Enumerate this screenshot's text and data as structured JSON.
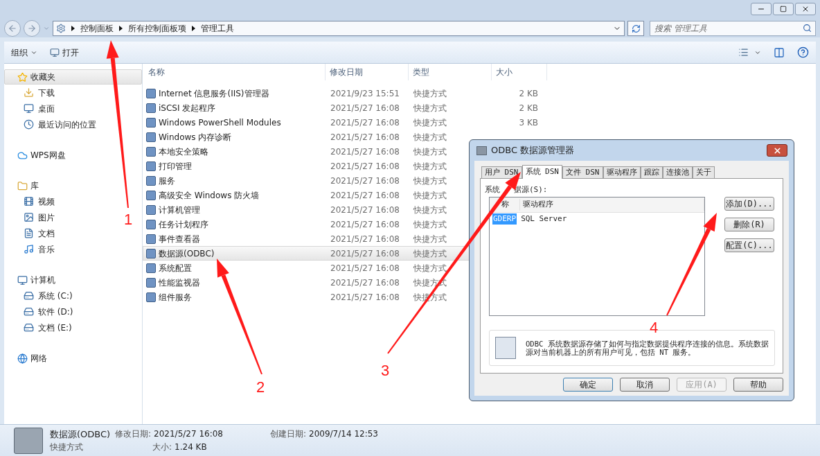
{
  "address_bar": {
    "breadcrumbs": [
      "控制面板",
      "所有控制面板项",
      "管理工具"
    ]
  },
  "search": {
    "placeholder": "搜索 管理工具"
  },
  "toolbar": {
    "items": [
      {
        "label": "组织",
        "kind": "menu"
      },
      {
        "label": "打开",
        "kind": "button"
      }
    ]
  },
  "sidebar": {
    "groups": [
      {
        "label": "收藏夹",
        "selected": true,
        "kind": "star",
        "children": [
          {
            "label": "下载",
            "kind": "download"
          },
          {
            "label": "桌面",
            "kind": "desktop"
          },
          {
            "label": "最近访问的位置",
            "kind": "recent"
          }
        ]
      },
      {
        "label": "WPS网盘",
        "selected": false,
        "kind": "cloud"
      },
      {
        "label": "库",
        "selected": false,
        "kind": "folder",
        "children": [
          {
            "label": "视频",
            "kind": "video"
          },
          {
            "label": "图片",
            "kind": "image"
          },
          {
            "label": "文档",
            "kind": "doc"
          },
          {
            "label": "音乐",
            "kind": "music"
          }
        ]
      },
      {
        "label": "计算机",
        "selected": false,
        "kind": "computer",
        "children": [
          {
            "label": "系统 (C:)",
            "kind": "drive"
          },
          {
            "label": "软件 (D:)",
            "kind": "drive"
          },
          {
            "label": "文档 (E:)",
            "kind": "drive"
          }
        ]
      },
      {
        "label": "网络",
        "selected": false,
        "kind": "network"
      }
    ]
  },
  "file_list": {
    "columns": [
      "名称",
      "修改日期",
      "类型",
      "大小"
    ],
    "rows": [
      {
        "name": "Internet 信息服务(IIS)管理器",
        "date": "2021/9/23 15:51",
        "type": "快捷方式",
        "size": "2 KB",
        "selected": false
      },
      {
        "name": "iSCSI 发起程序",
        "date": "2021/5/27 16:08",
        "type": "快捷方式",
        "size": "2 KB",
        "selected": false
      },
      {
        "name": "Windows PowerShell Modules",
        "date": "2021/5/27 16:08",
        "type": "快捷方式",
        "size": "3 KB",
        "selected": false
      },
      {
        "name": "Windows 内存诊断",
        "date": "2021/5/27 16:08",
        "type": "快捷方式",
        "selected": false
      },
      {
        "name": "本地安全策略",
        "date": "2021/5/27 16:08",
        "type": "快捷方式",
        "selected": false
      },
      {
        "name": "打印管理",
        "date": "2021/5/27 16:08",
        "type": "快捷方式",
        "selected": false
      },
      {
        "name": "服务",
        "date": "2021/5/27 16:08",
        "type": "快捷方式",
        "selected": false
      },
      {
        "name": "高级安全 Windows 防火墙",
        "date": "2021/5/27 16:08",
        "type": "快捷方式",
        "selected": false
      },
      {
        "name": "计算机管理",
        "date": "2021/5/27 16:08",
        "type": "快捷方式",
        "selected": false
      },
      {
        "name": "任务计划程序",
        "date": "2021/5/27 16:08",
        "type": "快捷方式",
        "selected": false
      },
      {
        "name": "事件查看器",
        "date": "2021/5/27 16:08",
        "type": "快捷方式",
        "selected": false
      },
      {
        "name": "数据源(ODBC)",
        "date": "2021/5/27 16:08",
        "type": "快捷方式",
        "selected": true
      },
      {
        "name": "系统配置",
        "date": "2021/5/27 16:08",
        "type": "快捷方式",
        "selected": false
      },
      {
        "name": "性能监视器",
        "date": "2021/5/27 16:08",
        "type": "快捷方式",
        "selected": false
      },
      {
        "name": "组件服务",
        "date": "2021/5/27 16:08",
        "type": "快捷方式",
        "selected": false
      }
    ]
  },
  "dialog": {
    "title": "ODBC 数据源管理器",
    "tabs": [
      {
        "label": "用户 DSN",
        "selected": false
      },
      {
        "label": "系统 DSN",
        "selected": true
      },
      {
        "label": "文件 DSN",
        "selected": false
      },
      {
        "label": "驱动程序",
        "selected": false
      },
      {
        "label": "跟踪",
        "selected": false
      },
      {
        "label": "连接池",
        "selected": false
      },
      {
        "label": "关于",
        "selected": false
      }
    ],
    "list_label_parts": [
      "系统",
      "据源(S):"
    ],
    "list_columns": [
      "称",
      "驱动程序"
    ],
    "list_rows": [
      {
        "name": "GDERP",
        "driver": "SQL Server",
        "selected": true
      }
    ],
    "side_buttons": [
      "添加(D)...",
      "删除(R)",
      "配置(C)..."
    ],
    "info_text": "ODBC 系统数据源存储了如何与指定数据提供程序连接的信息。系统数据源对当前机器上的所有用户可见，包括 NT 服务。",
    "footer_buttons": [
      {
        "label": "确定",
        "default": true,
        "disabled": false
      },
      {
        "label": "取消",
        "default": false,
        "disabled": false
      },
      {
        "label": "应用(A)",
        "default": false,
        "disabled": true
      },
      {
        "label": "帮助",
        "default": false,
        "disabled": false
      }
    ]
  },
  "status_bar": {
    "name": "数据源(ODBC)",
    "type": "快捷方式",
    "modified_label": "修改日期:",
    "modified": "2021/5/27 16:08",
    "size_label": "大小:",
    "size": "1.24 KB",
    "created_label": "创建日期:",
    "created": "2009/7/14 12:53"
  },
  "annotations": [
    {
      "label": "1"
    },
    {
      "label": "2"
    },
    {
      "label": "3"
    },
    {
      "label": "4"
    }
  ]
}
